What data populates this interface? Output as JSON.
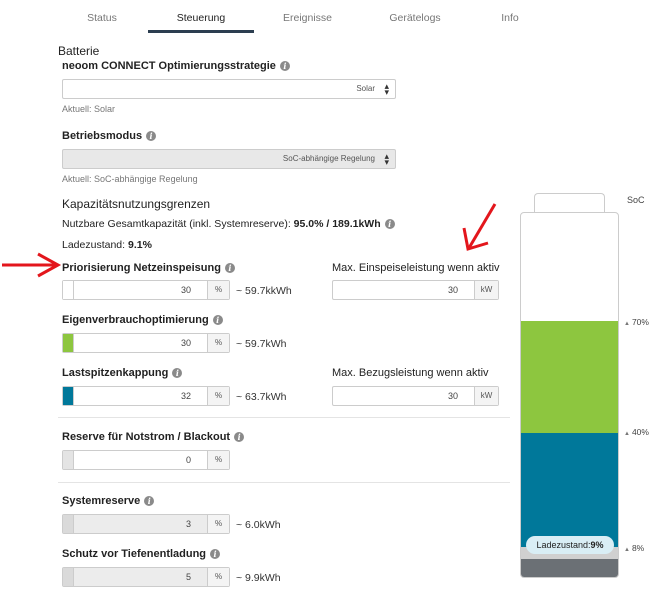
{
  "tabs": [
    {
      "label": "Status"
    },
    {
      "label": "Steuerung"
    },
    {
      "label": "Ereignisse"
    },
    {
      "label": "Gerätelogs"
    },
    {
      "label": "Info"
    }
  ],
  "active_tab": "Steuerung",
  "section_title": "Batterie",
  "strategy": {
    "label": "neoom CONNECT Optimierungsstrategie",
    "value": "Solar",
    "current": "Aktuell: Solar"
  },
  "mode": {
    "label": "Betriebsmodus",
    "value": "SoC-abhängige Regelung",
    "current": "Aktuell: SoC-abhängige Regelung"
  },
  "capacity": {
    "title": "Kapazitätsnutzungsgrenzen",
    "usable_prefix": "Nutzbare Gesamtkapazität (inkl. Systemreserve):",
    "usable_value": "95.0% / 189.1kWh",
    "charge_prefix": "Ladezustand:",
    "charge_value": "9.1%"
  },
  "fields": {
    "feed_in": {
      "label": "Priorisierung Netzeinspeisung",
      "value": "30",
      "unit": "%",
      "approx": "~ 59.7kkWh",
      "color": "#ffffff"
    },
    "self": {
      "label": "Eigenverbrauchoptimierung",
      "value": "30",
      "unit": "%",
      "approx": "~ 59.7kWh",
      "color": "#8dc63f"
    },
    "peak": {
      "label": "Lastspitzenkappung",
      "value": "32",
      "unit": "%",
      "approx": "~ 63.7kWh",
      "color": "#00789a"
    },
    "reserve": {
      "label": "Reserve für Notstrom / Blackout",
      "value": "0",
      "unit": "%"
    },
    "system": {
      "label": "Systemreserve",
      "value": "3",
      "unit": "%",
      "approx": "~ 6.0kWh"
    },
    "deep": {
      "label": "Schutz vor Tiefenentladung",
      "value": "5",
      "unit": "%",
      "approx": "~ 9.9kWh"
    }
  },
  "max_feed": {
    "label": "Max. Einspeiseleistung wenn aktiv",
    "value": "30",
    "unit": "kW"
  },
  "max_draw": {
    "label": "Max. Bezugsleistung wenn aktiv",
    "value": "30",
    "unit": "kW"
  },
  "battery": {
    "soc_label": "SoC",
    "ticks": [
      "70%",
      "40%",
      "8%"
    ],
    "badge_prefix": "Ladezustand:",
    "badge_value": "9%",
    "colors": {
      "green": "#8dc63f",
      "blue": "#00789a",
      "light": "#d0d0d0",
      "dark": "#6b7075"
    }
  },
  "annotations": {
    "arrow_color": "#e3161c"
  }
}
